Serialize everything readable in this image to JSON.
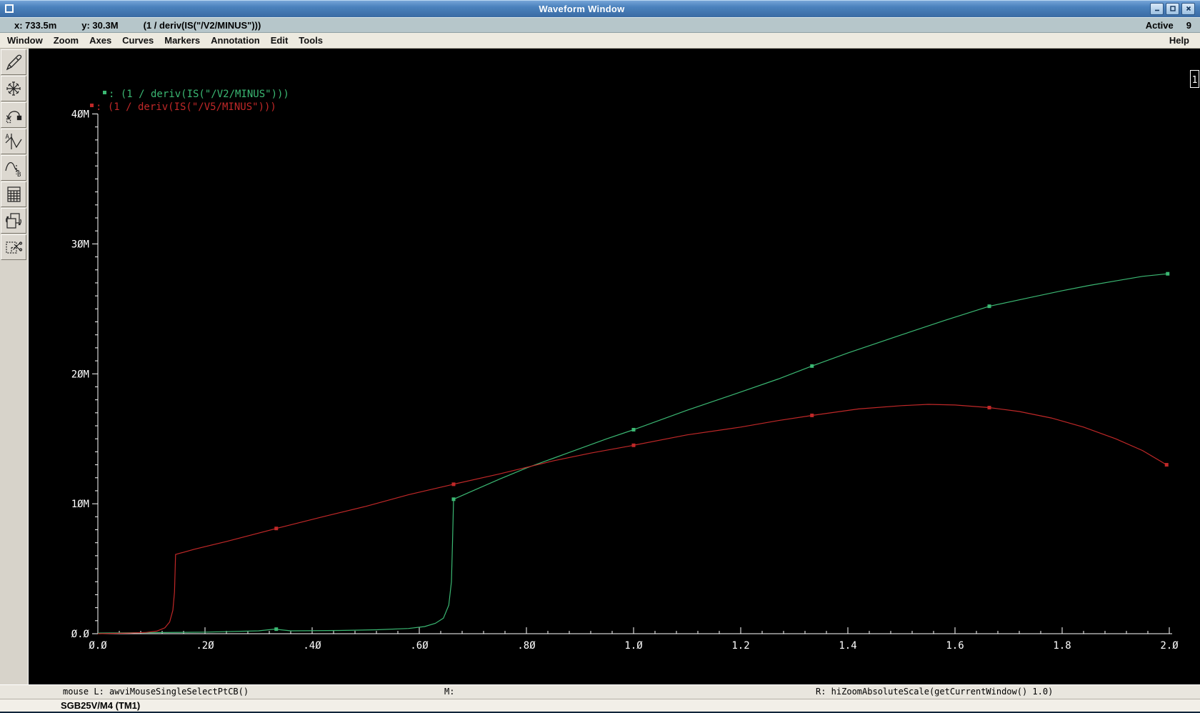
{
  "window": {
    "title": "Waveform Window",
    "controls": [
      {
        "name": "minimize-button",
        "icon": "minimize-icon"
      },
      {
        "name": "maximize-button",
        "icon": "maximize-icon"
      },
      {
        "name": "close-button",
        "icon": "close-icon"
      }
    ]
  },
  "infobar": {
    "x_readout": "x: 733.5m",
    "y_readout": "y: 30.3M",
    "expression": "(1 / deriv(IS(\"/V2/MINUS\")))",
    "active_label": "Active",
    "active_count": "9"
  },
  "menubar": {
    "items": [
      "Window",
      "Zoom",
      "Axes",
      "Curves",
      "Markers",
      "Annotation",
      "Edit",
      "Tools"
    ],
    "help": "Help"
  },
  "toolbar": {
    "buttons": [
      {
        "name": "pen-tool",
        "icon": "pen-icon"
      },
      {
        "name": "zoom-fit-tool",
        "icon": "star-arrows-icon"
      },
      {
        "name": "sweep-redraw-tool",
        "icon": "arc-arrow-icon"
      },
      {
        "name": "waveform-a-tool",
        "icon": "wave-a-icon"
      },
      {
        "name": "waveform-b-tool",
        "icon": "wave-b-icon"
      },
      {
        "name": "calculator-tool",
        "icon": "calculator-icon"
      },
      {
        "name": "copy-window-tool",
        "icon": "copy-window-icon"
      },
      {
        "name": "cut-subwindow-tool",
        "icon": "cut-scissors-icon"
      }
    ]
  },
  "plot": {
    "subwindow_number": "1"
  },
  "statusbar": {
    "left": "mouse L: awviMouseSingleSelectPtCB()",
    "middle": "M:",
    "right": "R: hiZoomAbsoluteScale(getCurrentWindow() 1.0)"
  },
  "footer": {
    "text": "SGB25V/M4 (TM1)"
  },
  "chart_data": {
    "type": "line",
    "title": "",
    "xlabel": "",
    "ylabel": "",
    "background": "#000000",
    "axis_color": "#ffffff",
    "grid": false,
    "legend_position": "top-left-inside",
    "xlim": [
      0.0,
      2.0
    ],
    "ylim": [
      0,
      40
    ],
    "y_unit": "M",
    "x_major_ticks": [
      0.0,
      0.2,
      0.4,
      0.6,
      0.8,
      1.0,
      1.2,
      1.4,
      1.6,
      1.8,
      2.0
    ],
    "x_tick_labels": [
      "Ø.Ø",
      ".2Ø",
      ".4Ø",
      ".6Ø",
      ".8Ø",
      "1.Ø",
      "1.2",
      "1.4",
      "1.6",
      "1.8",
      "2.Ø"
    ],
    "x_minor_step": 0.04,
    "y_major_ticks": [
      0,
      10,
      20,
      30,
      40
    ],
    "y_tick_labels": [
      "Ø.Ø",
      "1ØM",
      "2ØM",
      "3ØM",
      "4ØM"
    ],
    "y_minor_step": 1,
    "series": [
      {
        "id": "v2-minus",
        "name": "(1 / deriv(IS(\"/V2/MINUS\")))",
        "color": "#3bb873",
        "points": [
          [
            0.0,
            0.05
          ],
          [
            0.1,
            0.08
          ],
          [
            0.2,
            0.12
          ],
          [
            0.3,
            0.22
          ],
          [
            0.33,
            0.35
          ],
          [
            0.36,
            0.22
          ],
          [
            0.45,
            0.25
          ],
          [
            0.52,
            0.3
          ],
          [
            0.58,
            0.4
          ],
          [
            0.61,
            0.55
          ],
          [
            0.63,
            0.8
          ],
          [
            0.645,
            1.2
          ],
          [
            0.655,
            2.2
          ],
          [
            0.66,
            4.0
          ],
          [
            0.662,
            7.0
          ],
          [
            0.664,
            10.35
          ],
          [
            0.7,
            11.0
          ],
          [
            0.75,
            11.9
          ],
          [
            0.8,
            12.75
          ],
          [
            0.85,
            13.5
          ],
          [
            0.9,
            14.25
          ],
          [
            0.95,
            15.0
          ],
          [
            1.0,
            15.7
          ],
          [
            1.1,
            17.2
          ],
          [
            1.2,
            18.6
          ],
          [
            1.27,
            19.6
          ],
          [
            1.333,
            20.6
          ],
          [
            1.4,
            21.6
          ],
          [
            1.5,
            23.0
          ],
          [
            1.58,
            24.1
          ],
          [
            1.664,
            25.2
          ],
          [
            1.737,
            25.85
          ],
          [
            1.8,
            26.4
          ],
          [
            1.85,
            26.8
          ],
          [
            1.9,
            27.15
          ],
          [
            1.95,
            27.5
          ],
          [
            1.997,
            27.7
          ]
        ],
        "markers": [
          [
            0.333,
            0.35
          ],
          [
            0.664,
            10.35
          ],
          [
            1.0,
            15.7
          ],
          [
            1.333,
            20.6
          ],
          [
            1.664,
            25.2
          ],
          [
            1.997,
            27.7
          ]
        ]
      },
      {
        "id": "v5-minus",
        "name": "(1 / deriv(IS(\"/V5/MINUS\")))",
        "color": "#c02828",
        "points": [
          [
            0.0,
            0.0
          ],
          [
            0.06,
            0.05
          ],
          [
            0.09,
            0.1
          ],
          [
            0.11,
            0.2
          ],
          [
            0.125,
            0.45
          ],
          [
            0.134,
            0.9
          ],
          [
            0.14,
            1.8
          ],
          [
            0.143,
            3.2
          ],
          [
            0.145,
            6.1
          ],
          [
            0.18,
            6.5
          ],
          [
            0.24,
            7.1
          ],
          [
            0.333,
            8.1
          ],
          [
            0.42,
            9.0
          ],
          [
            0.5,
            9.8
          ],
          [
            0.58,
            10.7
          ],
          [
            0.664,
            11.5
          ],
          [
            0.75,
            12.3
          ],
          [
            0.85,
            13.3
          ],
          [
            0.92,
            13.9
          ],
          [
            1.0,
            14.5
          ],
          [
            1.1,
            15.3
          ],
          [
            1.2,
            15.9
          ],
          [
            1.27,
            16.4
          ],
          [
            1.333,
            16.8
          ],
          [
            1.42,
            17.3
          ],
          [
            1.5,
            17.55
          ],
          [
            1.55,
            17.65
          ],
          [
            1.6,
            17.6
          ],
          [
            1.664,
            17.4
          ],
          [
            1.72,
            17.1
          ],
          [
            1.78,
            16.6
          ],
          [
            1.84,
            15.9
          ],
          [
            1.9,
            15.0
          ],
          [
            1.95,
            14.1
          ],
          [
            1.995,
            13.0
          ]
        ],
        "markers": [
          [
            0.333,
            8.1
          ],
          [
            0.664,
            11.5
          ],
          [
            1.0,
            14.5
          ],
          [
            1.333,
            16.8
          ],
          [
            1.664,
            17.4
          ],
          [
            1.995,
            13.0
          ]
        ]
      }
    ]
  }
}
